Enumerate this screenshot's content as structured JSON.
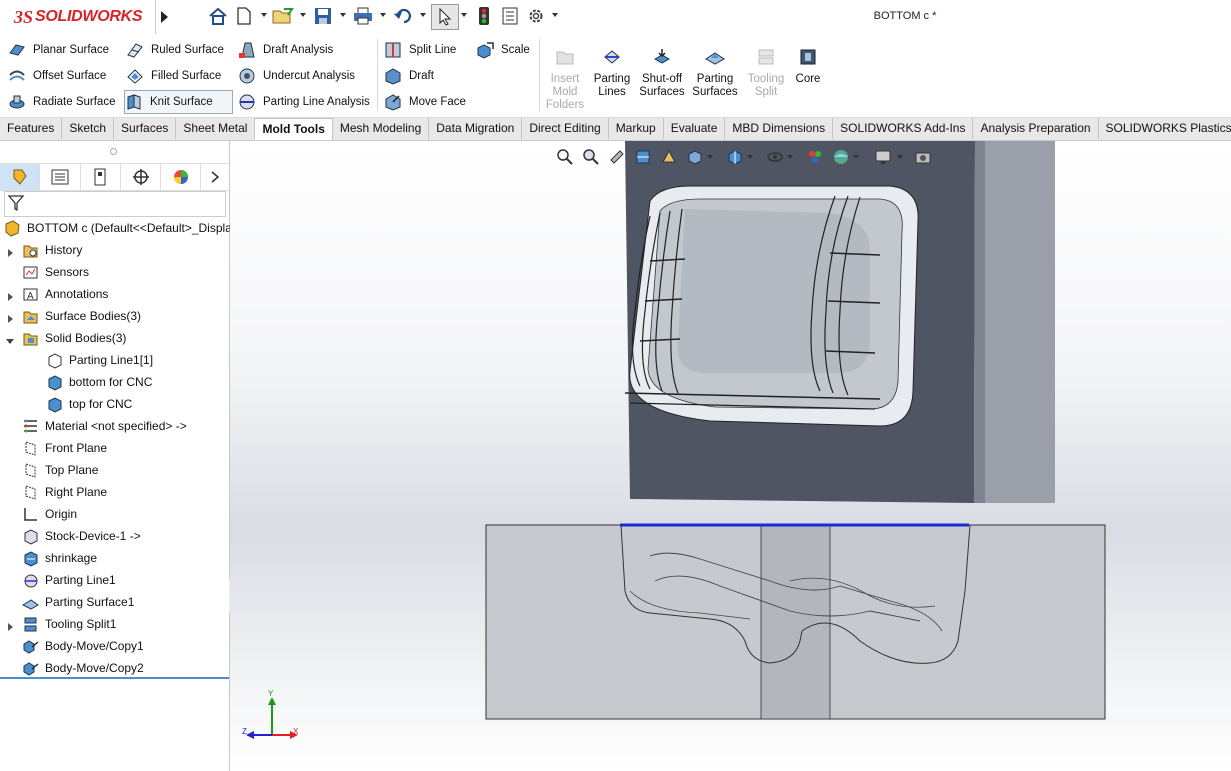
{
  "app": {
    "logo_ds": "3S",
    "logo_text": "SOLIDWORKS"
  },
  "window": {
    "title": "BOTTOM c *"
  },
  "quick_access": [
    "home-icon",
    "new-document-icon",
    "open-icon",
    "save-icon",
    "print-icon",
    "undo-icon",
    "select-icon",
    "rebuild-icon",
    "file-properties-icon",
    "options-icon"
  ],
  "ribbon": {
    "col1": [
      "Planar Surface",
      "Offset Surface",
      "Radiate Surface"
    ],
    "col2": [
      "Ruled Surface",
      "Filled Surface",
      "Knit Surface"
    ],
    "col3": [
      "Draft Analysis",
      "Undercut Analysis",
      "Parting Line Analysis"
    ],
    "col4": [
      "Split Line",
      "Draft",
      "Move Face"
    ],
    "col5": [
      "Scale"
    ],
    "big": [
      {
        "label": "Insert Mold Folders",
        "l1": "Insert",
        "l2": "Mold",
        "l3": "Folders",
        "enabled": false
      },
      {
        "label": "Parting Lines",
        "l1": "Parting",
        "l2": "Lines",
        "enabled": true
      },
      {
        "label": "Shut-off Surfaces",
        "l1": "Shut-off",
        "l2": "Surfaces",
        "enabled": true
      },
      {
        "label": "Parting Surfaces",
        "l1": "Parting",
        "l2": "Surfaces",
        "enabled": true
      },
      {
        "label": "Tooling Split",
        "l1": "Tooling",
        "l2": "Split",
        "enabled": false
      },
      {
        "label": "Core",
        "l1": "Core",
        "enabled": true
      }
    ],
    "active_tool": "Knit Surface"
  },
  "tabs": [
    "Features",
    "Sketch",
    "Surfaces",
    "Sheet Metal",
    "Mold Tools",
    "Mesh Modeling",
    "Data Migration",
    "Direct Editing",
    "Markup",
    "Evaluate",
    "MBD Dimensions",
    "SOLIDWORKS Add-Ins",
    "Analysis Preparation",
    "SOLIDWORKS Plastics"
  ],
  "active_tab": "Mold Tools",
  "tree": {
    "root": "BOTTOM c  (Default<<Default>_Displa",
    "items": [
      {
        "label": "History",
        "expander": true,
        "indent": 0
      },
      {
        "label": "Sensors",
        "expander": false,
        "indent": 0
      },
      {
        "label": "Annotations",
        "expander": true,
        "indent": 0
      },
      {
        "label": "Surface Bodies(3)",
        "expander": true,
        "indent": 0
      },
      {
        "label": "Solid Bodies(3)",
        "expander": "open",
        "indent": 0
      },
      {
        "label": "Parting Line1[1]",
        "expander": false,
        "indent": 1
      },
      {
        "label": "bottom for CNC",
        "expander": false,
        "indent": 1
      },
      {
        "label": "top for CNC",
        "expander": false,
        "indent": 1
      },
      {
        "label": "Material <not specified> ->",
        "expander": false,
        "indent": 0
      },
      {
        "label": "Front Plane",
        "expander": false,
        "indent": 0
      },
      {
        "label": "Top Plane",
        "expander": false,
        "indent": 0
      },
      {
        "label": "Right Plane",
        "expander": false,
        "indent": 0
      },
      {
        "label": "Origin",
        "expander": false,
        "indent": 0
      },
      {
        "label": "Stock-Device-1 ->",
        "expander": false,
        "indent": 0
      },
      {
        "label": "shrinkage",
        "expander": false,
        "indent": 0
      },
      {
        "label": "Parting Line1",
        "expander": false,
        "indent": 0
      },
      {
        "label": "Parting Surface1",
        "expander": false,
        "indent": 0
      },
      {
        "label": "Tooling Split1",
        "expander": true,
        "indent": 0
      },
      {
        "label": "Body-Move/Copy1",
        "expander": false,
        "indent": 0
      },
      {
        "label": "Body-Move/Copy2",
        "expander": false,
        "indent": 0
      }
    ]
  },
  "triad": {
    "y": "Y",
    "z": "Z",
    "x": "X"
  },
  "colors": {
    "accent": "#d8232a",
    "parting_line": "#1a2bd6",
    "mold_dark": "#4f5562",
    "mold_side": "#9aa0aa",
    "block_light": "#c6c9ce"
  }
}
